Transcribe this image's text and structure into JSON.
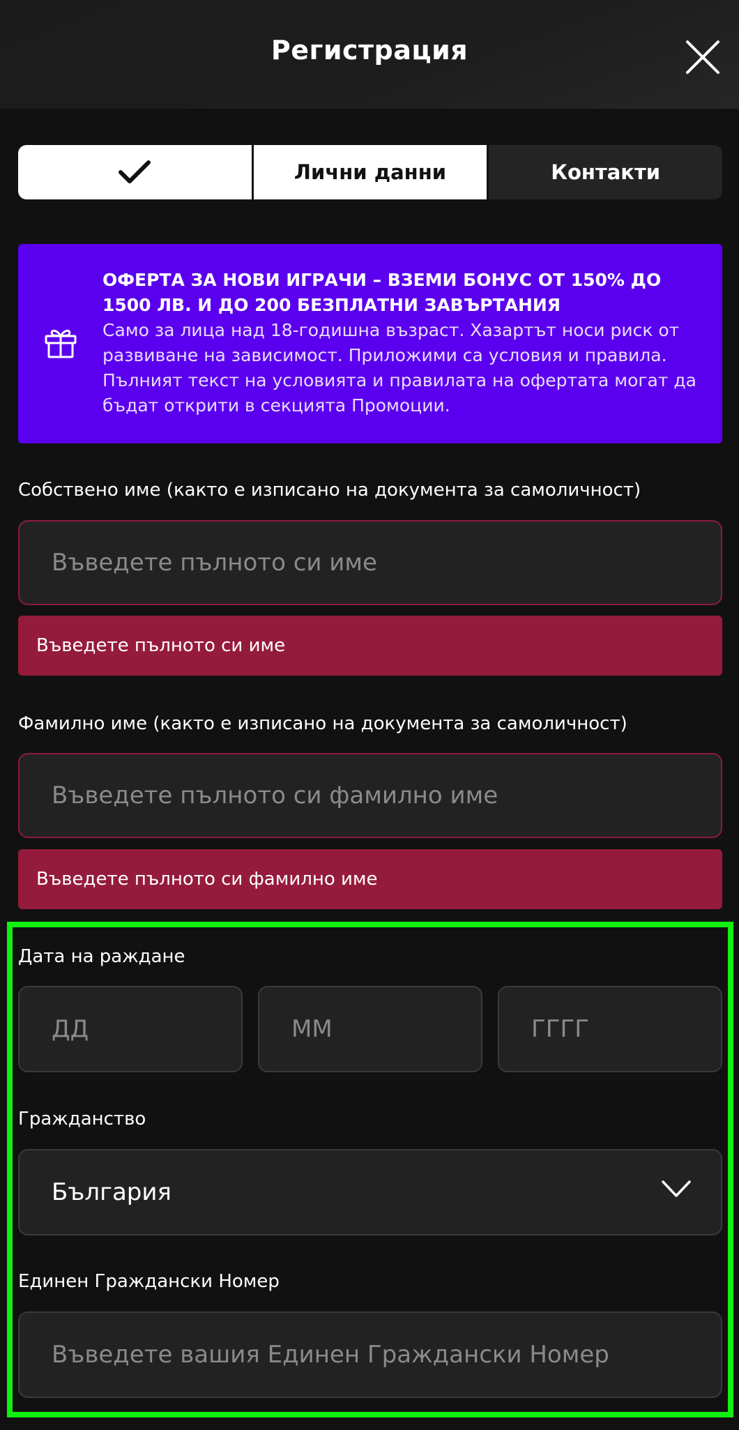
{
  "header": {
    "title": "Регистрация",
    "close_icon": "close-icon"
  },
  "steps": {
    "done_icon": "check-icon",
    "active_label": "Лични данни",
    "next_label": "Контакти"
  },
  "promo": {
    "icon": "gift-icon",
    "title": "ОФЕРТА ЗА НОВИ ИГРАЧИ – ВЗЕМИ БОНУС ОТ 150% ДО 1500 ЛВ. И ДО 200 БЕЗПЛАТНИ ЗАВЪРТАНИЯ",
    "body": "Само за лица над 18-годишна възраст. Хазартът носи риск от развиване на зависимост. Приложими са условия и правила. Пълният текст на условията и правилата на офертата могат да бъдат открити в секцията Промоции."
  },
  "form": {
    "first_name": {
      "label": "Собствено име (както е изписано на документа за самоличност)",
      "placeholder": "Въведете пълното си име",
      "error": "Въведете пълното си име"
    },
    "last_name": {
      "label": "Фамилно име (както е изписано на документа за самоличност)",
      "placeholder": "Въведете пълното си фамилно име",
      "error": "Въведете пълното си фамилно име"
    },
    "birth_date": {
      "label": "Дата на раждане",
      "day_placeholder": "ДД",
      "month_placeholder": "ММ",
      "year_placeholder": "ГГГГ"
    },
    "citizenship": {
      "label": "Гражданство",
      "value": "България",
      "icon": "chevron-down-icon"
    },
    "egn": {
      "label": "Единен Граждански Номер",
      "placeholder": "Въведете вашия Единен Граждански Номер"
    }
  },
  "colors": {
    "background": "#111111",
    "promo": "#5b00ee",
    "error": "#951b3d",
    "highlight": "#11f011"
  }
}
